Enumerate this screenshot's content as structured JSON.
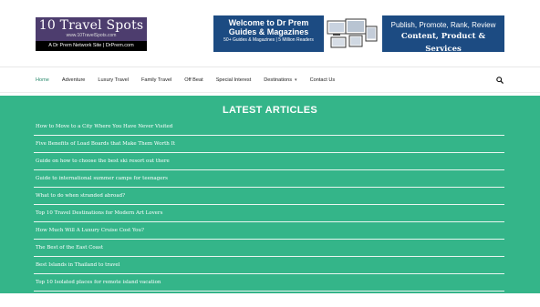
{
  "logo": {
    "title": "10 Travel Spots",
    "url": "www.10TravelSpots.com",
    "tagline": "A Dr Prem Network Site | DrPrem.com"
  },
  "banner": {
    "line1": "Welcome to Dr Prem",
    "line2": "Guides & Magazines",
    "line3": "50+ Guides & Magazines | 5 Million Readers",
    "right1": "Publish, Promote, Rank, Review",
    "right2": "Content, Product & Services"
  },
  "nav": {
    "items": [
      "Home",
      "Adventure",
      "Luxury Travel",
      "Family Travel",
      "Off Beat",
      "Special Interest",
      "Destinations",
      "Contact Us"
    ],
    "active": "Home",
    "accent": "#2b8a6e"
  },
  "articles": {
    "heading": "LATEST ARTICLES",
    "background": "#34b589",
    "items": [
      "How to Move to a City Where You Have Never Visited",
      "Five Benefits of Load Boards that Make Them Worth It",
      "Guide on how to choose the best ski resort out there",
      "Guide to international summer camps for teenagers",
      "What to do when stranded abroad?",
      "Top 10 Travel Destinations for Modern Art Lovers",
      "How Much Will A Luxury Cruise Cost You?",
      "The Best of the East Coast",
      "Best Islands in Thailand to travel",
      "Top 10 Isolated places for remote island vacation"
    ]
  }
}
